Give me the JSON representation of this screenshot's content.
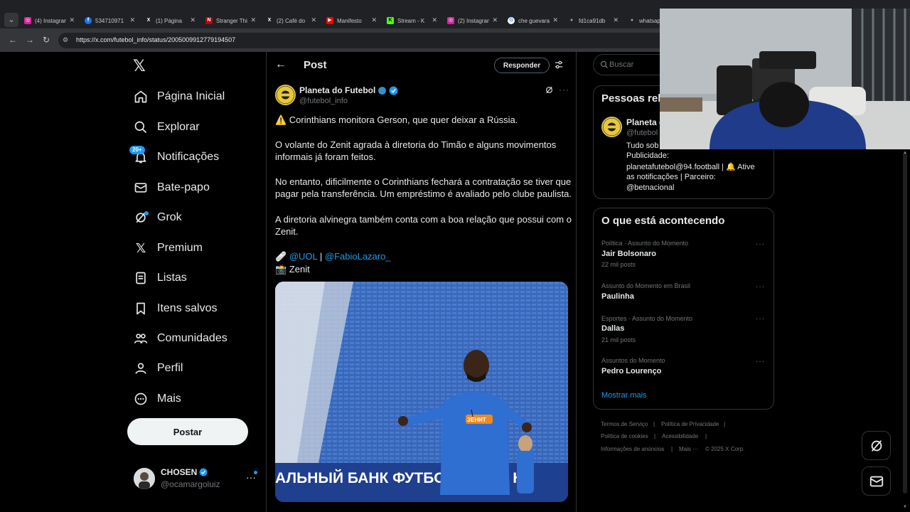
{
  "browser": {
    "tabs": [
      {
        "title": "(4) Instagram",
        "icon": "instagram-icon",
        "color": "#d6249f",
        "glyph": "◎"
      },
      {
        "title": "534710971",
        "icon": "facebook-icon",
        "color": "#1877f2",
        "glyph": "f"
      },
      {
        "title": "(1) Página",
        "icon": "x-icon",
        "color": "#000000",
        "glyph": "X"
      },
      {
        "title": "Stranger Things",
        "icon": "netflix-icon",
        "color": "#b20710",
        "glyph": "N"
      },
      {
        "title": "(2) Café do",
        "icon": "x-icon",
        "color": "#000000",
        "glyph": "X"
      },
      {
        "title": "Manifesto",
        "icon": "youtube-icon",
        "color": "#ff0000",
        "glyph": "▶"
      },
      {
        "title": "Stream - K",
        "icon": "kick-icon",
        "color": "#53fc18",
        "glyph": "K"
      },
      {
        "title": "(2) Instagram",
        "icon": "instagram-icon",
        "color": "#d6249f",
        "glyph": "◎"
      },
      {
        "title": "che guevara",
        "icon": "google-icon",
        "color": "#ffffff",
        "glyph": "G"
      },
      {
        "title": "fd1ca91db",
        "icon": "globe-icon",
        "color": "#9aa0a6",
        "glyph": "●"
      },
      {
        "title": "whatsapp",
        "icon": "globe-icon",
        "color": "#9aa0a6",
        "glyph": "●"
      }
    ],
    "url": "https://x.com/futebol_info/status/2005009912779194507"
  },
  "sidebar": {
    "items": [
      {
        "label": "Página Inicial",
        "icon": "home-icon"
      },
      {
        "label": "Explorar",
        "icon": "search-icon"
      },
      {
        "label": "Notificações",
        "icon": "bell-icon",
        "badge": "20+"
      },
      {
        "label": "Bate-papo",
        "icon": "envelope-icon"
      },
      {
        "label": "Grok",
        "icon": "grok-icon"
      },
      {
        "label": "Premium",
        "icon": "x-logo-icon"
      },
      {
        "label": "Listas",
        "icon": "list-icon"
      },
      {
        "label": "Itens salvos",
        "icon": "bookmark-icon"
      },
      {
        "label": "Comunidades",
        "icon": "people-icon"
      },
      {
        "label": "Perfil",
        "icon": "person-icon"
      },
      {
        "label": "Mais",
        "icon": "more-circle-icon"
      }
    ],
    "post_button": "Postar",
    "account": {
      "name": "CHOSEN",
      "handle": "@ocamargoluiz"
    }
  },
  "post": {
    "header_title": "Post",
    "reply_button": "Responder",
    "author_name": "Planeta do Futebol",
    "author_handle": "@futebol_info",
    "lines": [
      "⚠️ Corinthians monitora Gerson, que quer deixar a Rússia.",
      "O volante do Zenit agrada à diretoria do Timão e alguns movimentos",
      "informais já foram feitos.",
      "No entanto, dificilmente o Corinthians fechará a contratação se tiver que",
      "pagar pela transferência. Um empréstimo é avaliado pelo clube paulista.",
      "A diretoria alvinegra também conta com a boa relação que possui com o",
      "Zenit."
    ],
    "source_prefix": "🩹",
    "source_link_1": "@UOL",
    "source_sep": " | ",
    "source_link_2": "@FabioLazaro_",
    "photo_credit": "📸 Zenit",
    "image_banner_text": "АЛЬНЫЙ БАНК ФУТБОЛЬНОГО К",
    "jersey_sponsor": "ЗЕНИТ"
  },
  "right": {
    "search_placeholder": "Buscar",
    "related_title": "Pessoas rel",
    "related": {
      "name": "Planeta d",
      "handle": "@futebol",
      "bio_lines": [
        "Tudo sob",
        "Publicidade:",
        "planetafutebol@94.football | 🔔 Ative",
        "as notificações | Parceiro:"
      ],
      "bio_link": "@betnacional"
    },
    "trends_title": "O que está acontecendo",
    "trends": [
      {
        "context": "Política · Assunto do Momento",
        "name": "Jair Bolsonaro",
        "count": "22 mil posts"
      },
      {
        "context": "Assunto do Momento em Brasil",
        "name": "Paulinha",
        "count": ""
      },
      {
        "context": "Esportes · Assunto do Momento",
        "name": "Dallas",
        "count": "21 mil posts"
      },
      {
        "context": "Assuntos do Momento",
        "name": "Pedro Lourenço",
        "count": ""
      }
    ],
    "show_more": "Mostrar mais",
    "footer": [
      "Termos de Serviço",
      "|",
      "Política de Privacidade",
      "|",
      "Política de cookies",
      "|",
      "Acessibilidade",
      "|",
      "Informações de anúncios",
      "|",
      "Mais ···",
      "© 2025 X Corp."
    ]
  },
  "colors": {
    "accent": "#1d9bf0",
    "background": "#000000",
    "border": "#2f3336",
    "muted": "#71767b"
  }
}
